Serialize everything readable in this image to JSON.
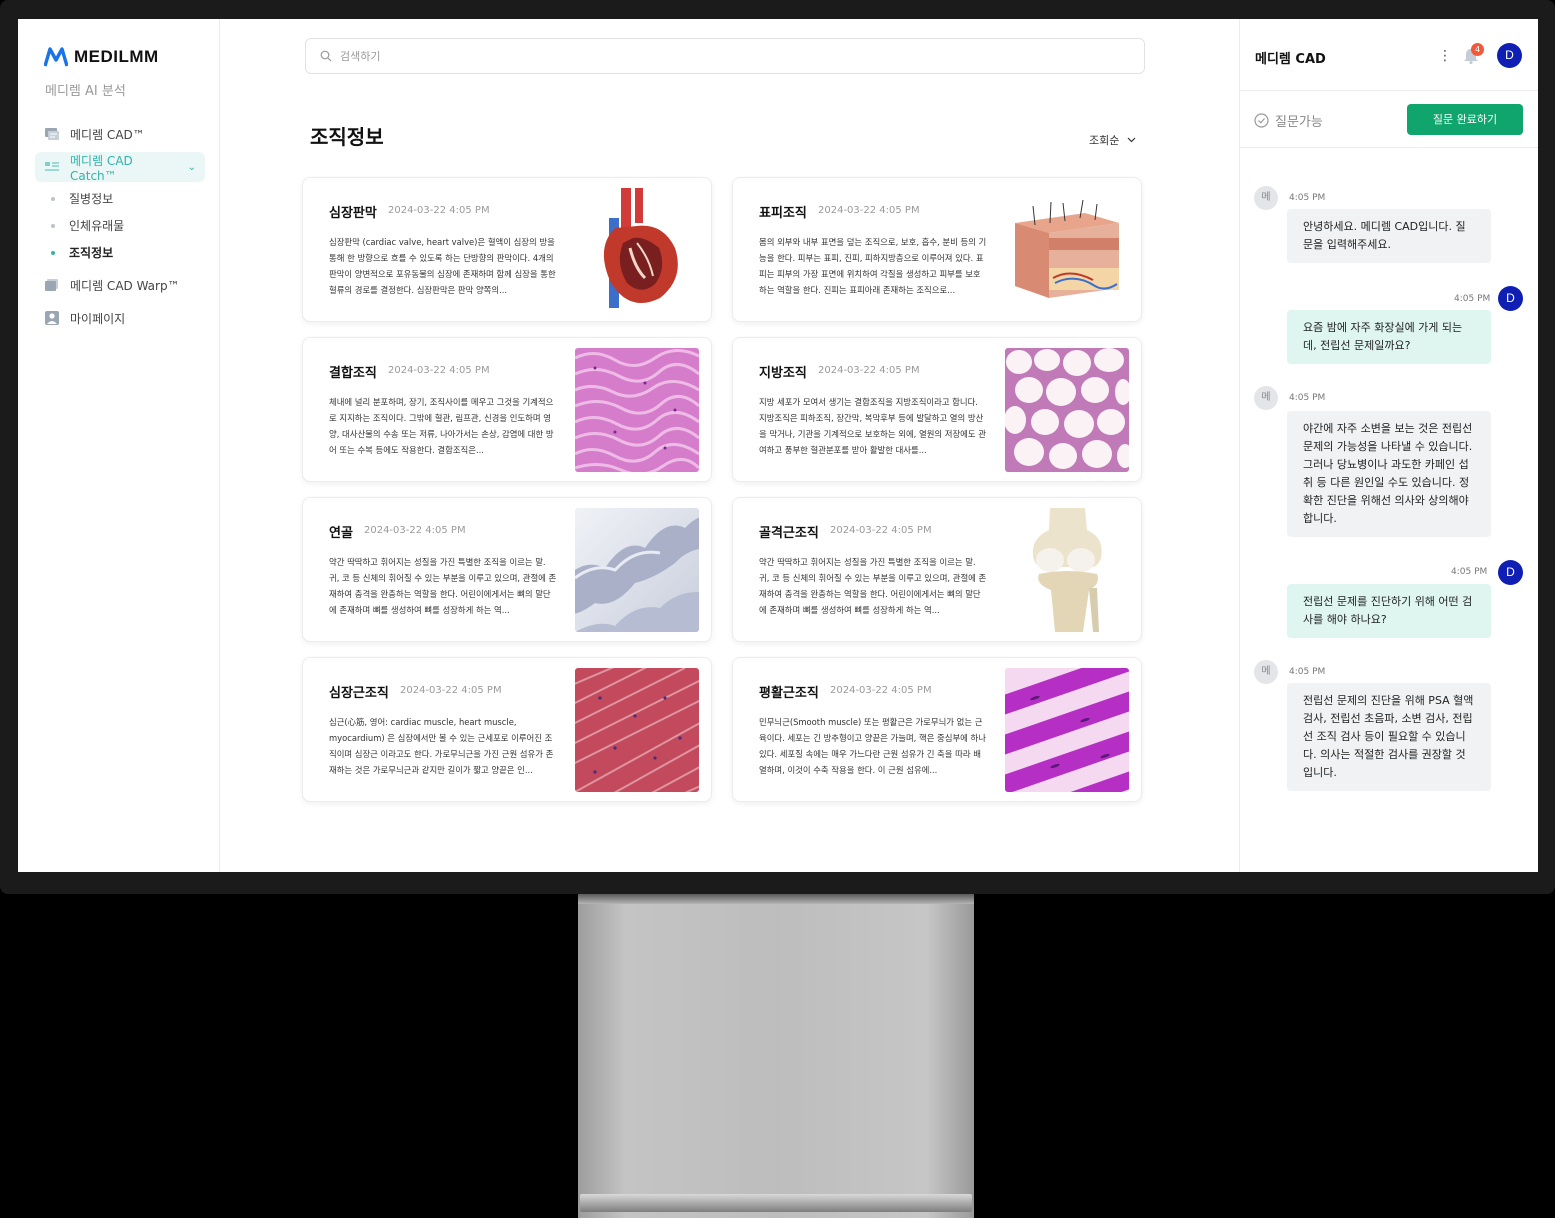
{
  "brand": {
    "name": "MEDILMM",
    "subtitle": "메디렘 AI 분석"
  },
  "sidebar": {
    "items": [
      {
        "label": "메디렘 CAD™",
        "icon": "cad-icon"
      },
      {
        "label": "메디렘 CAD Catch™",
        "icon": "catch-icon"
      },
      {
        "label": "메디렘 CAD Warp™",
        "icon": "warp-icon"
      },
      {
        "label": "마이페이지",
        "icon": "user-icon"
      }
    ],
    "subitems": [
      "질병정보",
      "인체유래물",
      "조직정보"
    ]
  },
  "search": {
    "placeholder": "검색하기"
  },
  "page": {
    "title": "조직정보",
    "sort_label": "조회순"
  },
  "cards": [
    {
      "title": "심장판막",
      "date": "2024-03-22 4:05 PM",
      "desc": "심장판막 (cardiac valve, heart valve)은 혈액이 심장의 방을 통해 한 방향으로 흐를 수 있도록 하는 단방향의 판막이다. 4개의 판막이 양변적으로 포유동물의 심장에 존재하며 함께 심장을 통한 혈류의 경로를 결정한다. 심장판막은 판막 양쪽의..."
    },
    {
      "title": "표피조직",
      "date": "2024-03-22 4:05 PM",
      "desc": "몸의 외부와 내부 표면을 덮는 조직으로, 보호, 흡수, 분비 등의 기능을 한다. 피부는 표피, 진피, 피하지방층으로 이루어져 있다. 표피는 피부의 가장 표면에 위치하여 각질을 생성하고 피부를 보호하는 역할을 한다. 진피는 표피아래 존재하는 조직으로..."
    },
    {
      "title": "결합조직",
      "date": "2024-03-22 4:05 PM",
      "desc": "체내에 널리 분포하며, 장기, 조직사이를 메우고 그것을 기계적으로 지지하는 조직이다. 그밖에 혈관, 림프관, 신경을 인도하며 영양, 대사산물의 수송 또는 저류, 나아가서는 손상, 감염에 대한 방어 또는 수복 등에도 작용한다. 결합조직은..."
    },
    {
      "title": "지방조직",
      "date": "2024-03-22 4:05 PM",
      "desc": "지방 세포가 모여서 생기는 결합조직을 지방조직이라고 합니다. 지방조직은 피하조직, 장간막, 복막후부 등에 발달하고 열의 방산을 막거나, 기관을 기계적으로 보호하는 외에, 열원의 저장에도 관여하고 풍부한 혈관분포를 받아 활발한 대사를..."
    },
    {
      "title": "연골",
      "date": "2024-03-22 4:05 PM",
      "desc": "약간 딱딱하고 휘어지는 성질을 가진 특별한 조직을 이르는 말. 귀, 코 등 신체의 휘어질 수 있는 부분을 이루고 있으며, 관절에 존재하여 충격을 완충하는 역할을 한다. 어린이에게서는 뼈의 말단에 존재하며 뼈를 생성하여 뼈를 성장하게 하는 역..."
    },
    {
      "title": "골격근조직",
      "date": "2024-03-22 4:05 PM",
      "desc": "약간 딱딱하고 휘어지는 성질을 가진 특별한 조직을 이르는 말. 귀, 코 등 신체의 휘어질 수 있는 부분을 이루고 있으며, 관절에 존재하여 충격을 완충하는 역할을 한다. 어린이에게서는 뼈의 말단에 존재하며 뼈를 생성하여 뼈를 성장하게 하는 역..."
    },
    {
      "title": "심장근조직",
      "date": "2024-03-22 4:05 PM",
      "desc": "심근(心筋, 영어: cardiac muscle, heart muscle, myocardium) 은 심장에서만 볼 수 있는 근세포로 이루어진 조직이며 심장근 이라고도 한다. 가로무늬근을 가진 근원 섬유가 존재하는 것은 가로무늬근과 같지만 길이가 짧고 양끝은 인..."
    },
    {
      "title": "평활근조직",
      "date": "2024-03-22 4:05 PM",
      "desc": "민무늬근(Smooth muscle) 또는 평활근은 가로무늬가 없는 근육이다. 세포는 긴 방추형이고 양끝은 가늘며, 핵은 중심부에 하나 있다. 세포질 속에는 매우 가느다란 근원 섬유가 긴 축을 따라 배열하며, 이것이 수축 작용을 한다. 이 근원 섬유에..."
    }
  ],
  "chat": {
    "title": "메디렘 CAD",
    "notification_count": "4",
    "user_initial": "D",
    "bot_initial": "메",
    "status": "질문가능",
    "done_button": "질문 완료하기",
    "messages": [
      {
        "from": "bot",
        "time": "4:05 PM",
        "text": "안녕하세요. 메디렘 CAD입니다. 질문을 입력해주세요."
      },
      {
        "from": "user",
        "time": "4:05 PM",
        "text": "요즘 밤에 자주 화장실에 가게 되는데, 전립선 문제일까요?"
      },
      {
        "from": "bot",
        "time": "4:05 PM",
        "text": "야간에 자주 소변을 보는 것은 전립선 문제의 가능성을 나타낼 수 있습니다. 그러나 당뇨병이나 과도한 카페인 섭취 등 다른 원인일 수도 있습니다. 정확한 진단을 위해선 의사와 상의해야 합니다."
      },
      {
        "from": "user",
        "time": "4:05 PM",
        "text": "전립선 문제를 진단하기 위해 어떤 검사를 해야 하나요?"
      },
      {
        "from": "bot",
        "time": "4:05 PM",
        "text": "전립선 문제의 진단을 위해 PSA 혈액 검사, 전립선 초음파, 소변 검사, 전립선 조직 검사 등이 필요할 수 있습니다. 의사는 적절한 검사를 권장할 것입니다."
      }
    ]
  },
  "colors": {
    "accent": "#33b3a9",
    "primary_button": "#0fa56d",
    "avatar": "#0f1fb4",
    "badge": "#f05a3a"
  }
}
